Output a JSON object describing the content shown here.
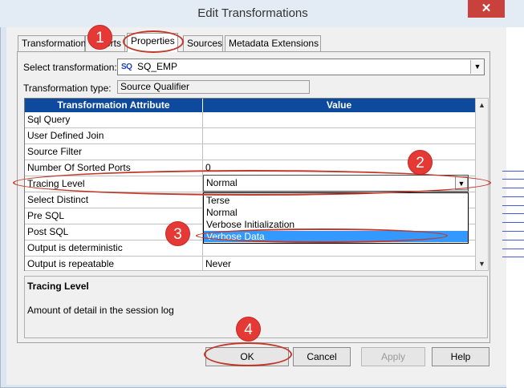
{
  "window": {
    "title": "Edit Transformations",
    "close_glyph": "✕"
  },
  "tabs": [
    {
      "label": "Transformation"
    },
    {
      "label": "Ports"
    },
    {
      "label": "Properties"
    },
    {
      "label": "Sources"
    },
    {
      "label": "Metadata Extensions"
    }
  ],
  "select_transformation": {
    "label": "Select transformation:",
    "badge": "SQ",
    "value": "SQ_EMP"
  },
  "transformation_type": {
    "label": "Transformation type:",
    "value": "Source Qualifier"
  },
  "grid": {
    "headers": [
      "Transformation Attribute",
      "Value"
    ],
    "rows": [
      {
        "attr": "Sql Query",
        "value": ""
      },
      {
        "attr": "User Defined Join",
        "value": ""
      },
      {
        "attr": "Source Filter",
        "value": ""
      },
      {
        "attr": "Number Of Sorted Ports",
        "value": "0"
      },
      {
        "attr": "Tracing Level",
        "value": "Normal"
      },
      {
        "attr": "Select Distinct",
        "value": ""
      },
      {
        "attr": "Pre SQL",
        "value": ""
      },
      {
        "attr": "Post SQL",
        "value": ""
      },
      {
        "attr": "Output is deterministic",
        "value": ""
      },
      {
        "attr": "Output is repeatable",
        "value": "Never"
      }
    ]
  },
  "dropdown": {
    "options": [
      "Terse",
      "Normal",
      "Verbose Initialization",
      "Verbose Data"
    ],
    "highlighted": "Verbose Data"
  },
  "description": {
    "title": "Tracing Level",
    "text": "Amount of detail in the session log"
  },
  "buttons": {
    "ok": "OK",
    "cancel": "Cancel",
    "apply": "Apply",
    "help": "Help"
  },
  "annotations": [
    "1",
    "2",
    "3",
    "4"
  ],
  "colors": {
    "header_bg": "#0d4a9e",
    "selection": "#3399ff",
    "annotation": "#e53935",
    "close_button": "#c8413c"
  },
  "icons": {
    "dropdown_arrow": "▼",
    "scroll_up": "▲",
    "scroll_down": "▼"
  }
}
